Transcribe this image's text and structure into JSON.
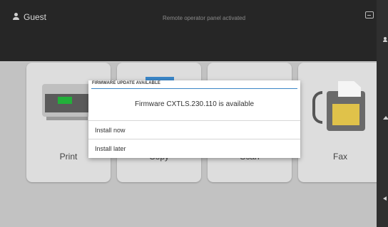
{
  "header": {
    "user_name": "Guest",
    "remote_status": "Remote operator panel activated"
  },
  "tiles": [
    {
      "label": "Print"
    },
    {
      "label": "Copy"
    },
    {
      "label": "Scan"
    },
    {
      "label": "Fax"
    }
  ],
  "dialog": {
    "title": "FIRMWARE UPDATE AVAILABLE",
    "message": "Firmware CXTLS.230.110 is available",
    "options": [
      {
        "label": "Install now"
      },
      {
        "label": "Install later"
      }
    ]
  },
  "icons": [
    "user-icon",
    "keyboard-icon",
    "printer-icon",
    "copy-icon",
    "fax-icon",
    "home-icon",
    "back-icon"
  ],
  "colors": {
    "accent": "#3b86c7",
    "printer_display": "#22b03a",
    "fax_keypad": "#e0c24a"
  }
}
